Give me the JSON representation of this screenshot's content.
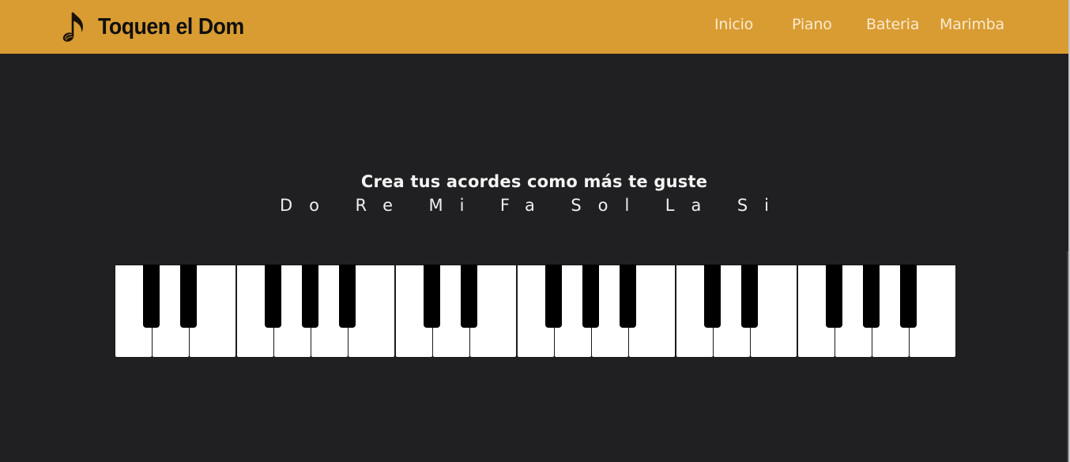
{
  "header": {
    "brand": {
      "title": "Toquen el Dom",
      "icon": "music-note-icon"
    },
    "nav": [
      {
        "label": "Inicio"
      },
      {
        "label": "Piano"
      },
      {
        "label": "Bateria"
      },
      {
        "label": "Marimba"
      }
    ]
  },
  "main": {
    "headline": "Crea tus acordes como más te guste",
    "notes": [
      "Do",
      "Re",
      "Mi",
      "Fa",
      "Sol",
      "La",
      "Si"
    ]
  },
  "piano": {
    "octave_groups": [
      {
        "white_keys": 3,
        "black_keys": 2
      },
      {
        "white_keys": 4,
        "black_keys": 3
      },
      {
        "white_keys": 3,
        "black_keys": 2
      },
      {
        "white_keys": 4,
        "black_keys": 3
      },
      {
        "white_keys": 3,
        "black_keys": 2
      },
      {
        "white_keys": 4,
        "black_keys": 3
      }
    ]
  },
  "colors": {
    "header_bg": "#d89c32",
    "page_bg": "#202022",
    "brand_text": "#0f0f10",
    "nav_text": "#fbead0",
    "white_key": "#ffffff",
    "black_key": "#000000"
  }
}
